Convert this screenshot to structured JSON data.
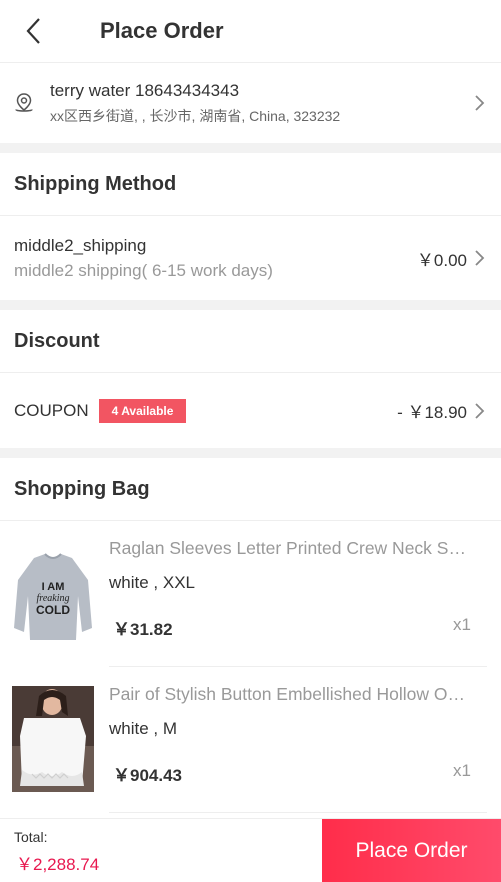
{
  "header": {
    "title": "Place Order"
  },
  "address": {
    "name_phone": "terry water 18643434343",
    "line": "xx区西乡街道, , 长沙市, 湖南省, China, 323232"
  },
  "shipping": {
    "title": "Shipping Method",
    "method_name": "middle2_shipping",
    "method_desc": "middle2 shipping( 6-15 work days)",
    "price": "￥0.00"
  },
  "discount": {
    "title": "Discount",
    "coupon_label": "COUPON",
    "badge": "4 Available",
    "amount": "- ￥18.90"
  },
  "bag": {
    "title": "Shopping Bag",
    "items": [
      {
        "name": "Raglan Sleeves Letter Printed Crew Neck Sweatshirt",
        "attrs": "white , XXL",
        "price": "￥31.82",
        "qty": "x1",
        "print": [
          "I AM",
          "freaking",
          "COLD"
        ]
      },
      {
        "name": "Pair of Stylish Button Embellished Hollow Out Blouse",
        "attrs": "white , M",
        "price": "￥904.43",
        "qty": "x1"
      }
    ]
  },
  "footer": {
    "total_label": "Total:",
    "total_value": "￥2,288.74",
    "button": "Place Order"
  },
  "colors": {
    "accent": "#ff2d4a",
    "badge": "#f25562",
    "total": "#e8184f"
  },
  "icons": [
    "back-arrow-icon",
    "location-pin-icon",
    "chevron-right-icon"
  ]
}
